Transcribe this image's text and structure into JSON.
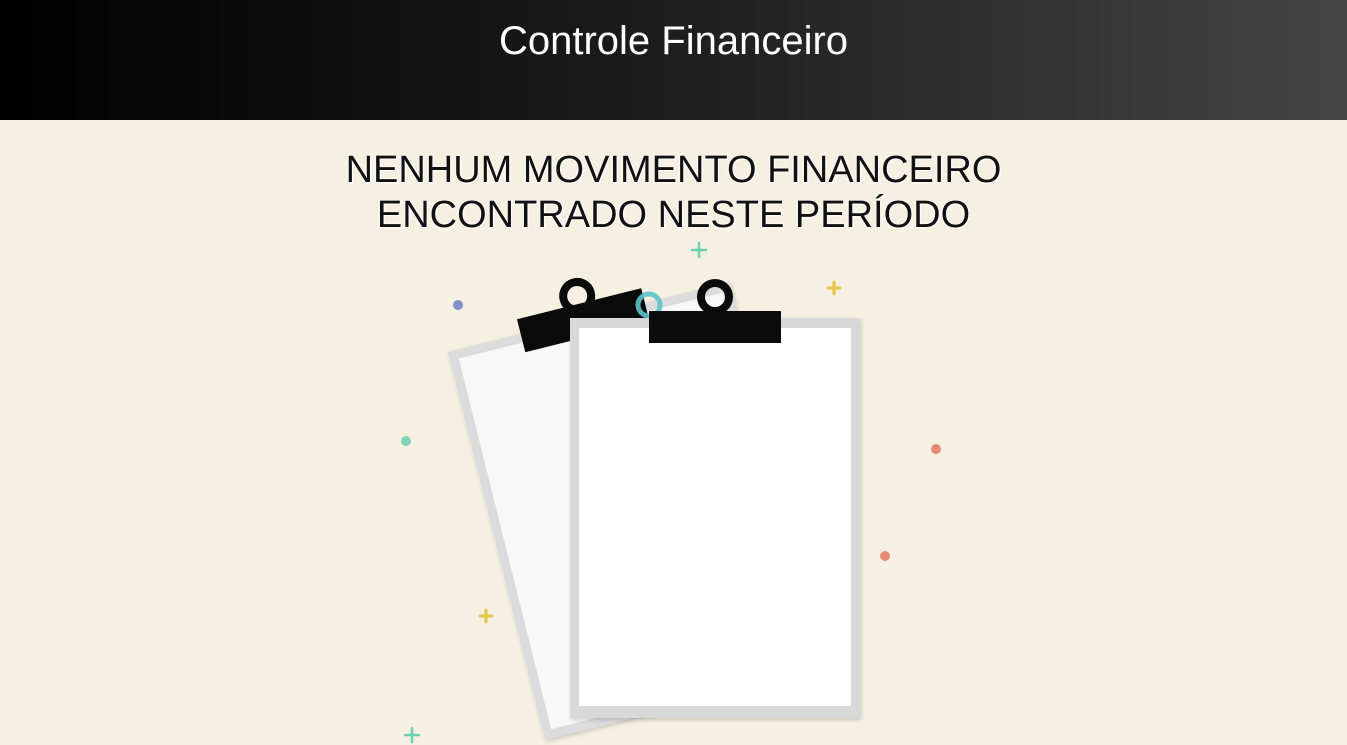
{
  "header": {
    "title": "Controle Financeiro"
  },
  "empty_state": {
    "line1": "NENHUM MOVIMENTO FINANCEIRO",
    "line2": "ENCONTRADO NESTE PERÍODO",
    "illustration_icon": "clipboard-icon"
  },
  "colors": {
    "header_start": "#000000",
    "header_end": "#454545",
    "background": "#f6f0e3",
    "confetti_green": "#6fcfb0",
    "confetti_blue": "#6b7fc4",
    "confetti_yellow": "#e8c64a",
    "confetti_red": "#e07a5f"
  }
}
